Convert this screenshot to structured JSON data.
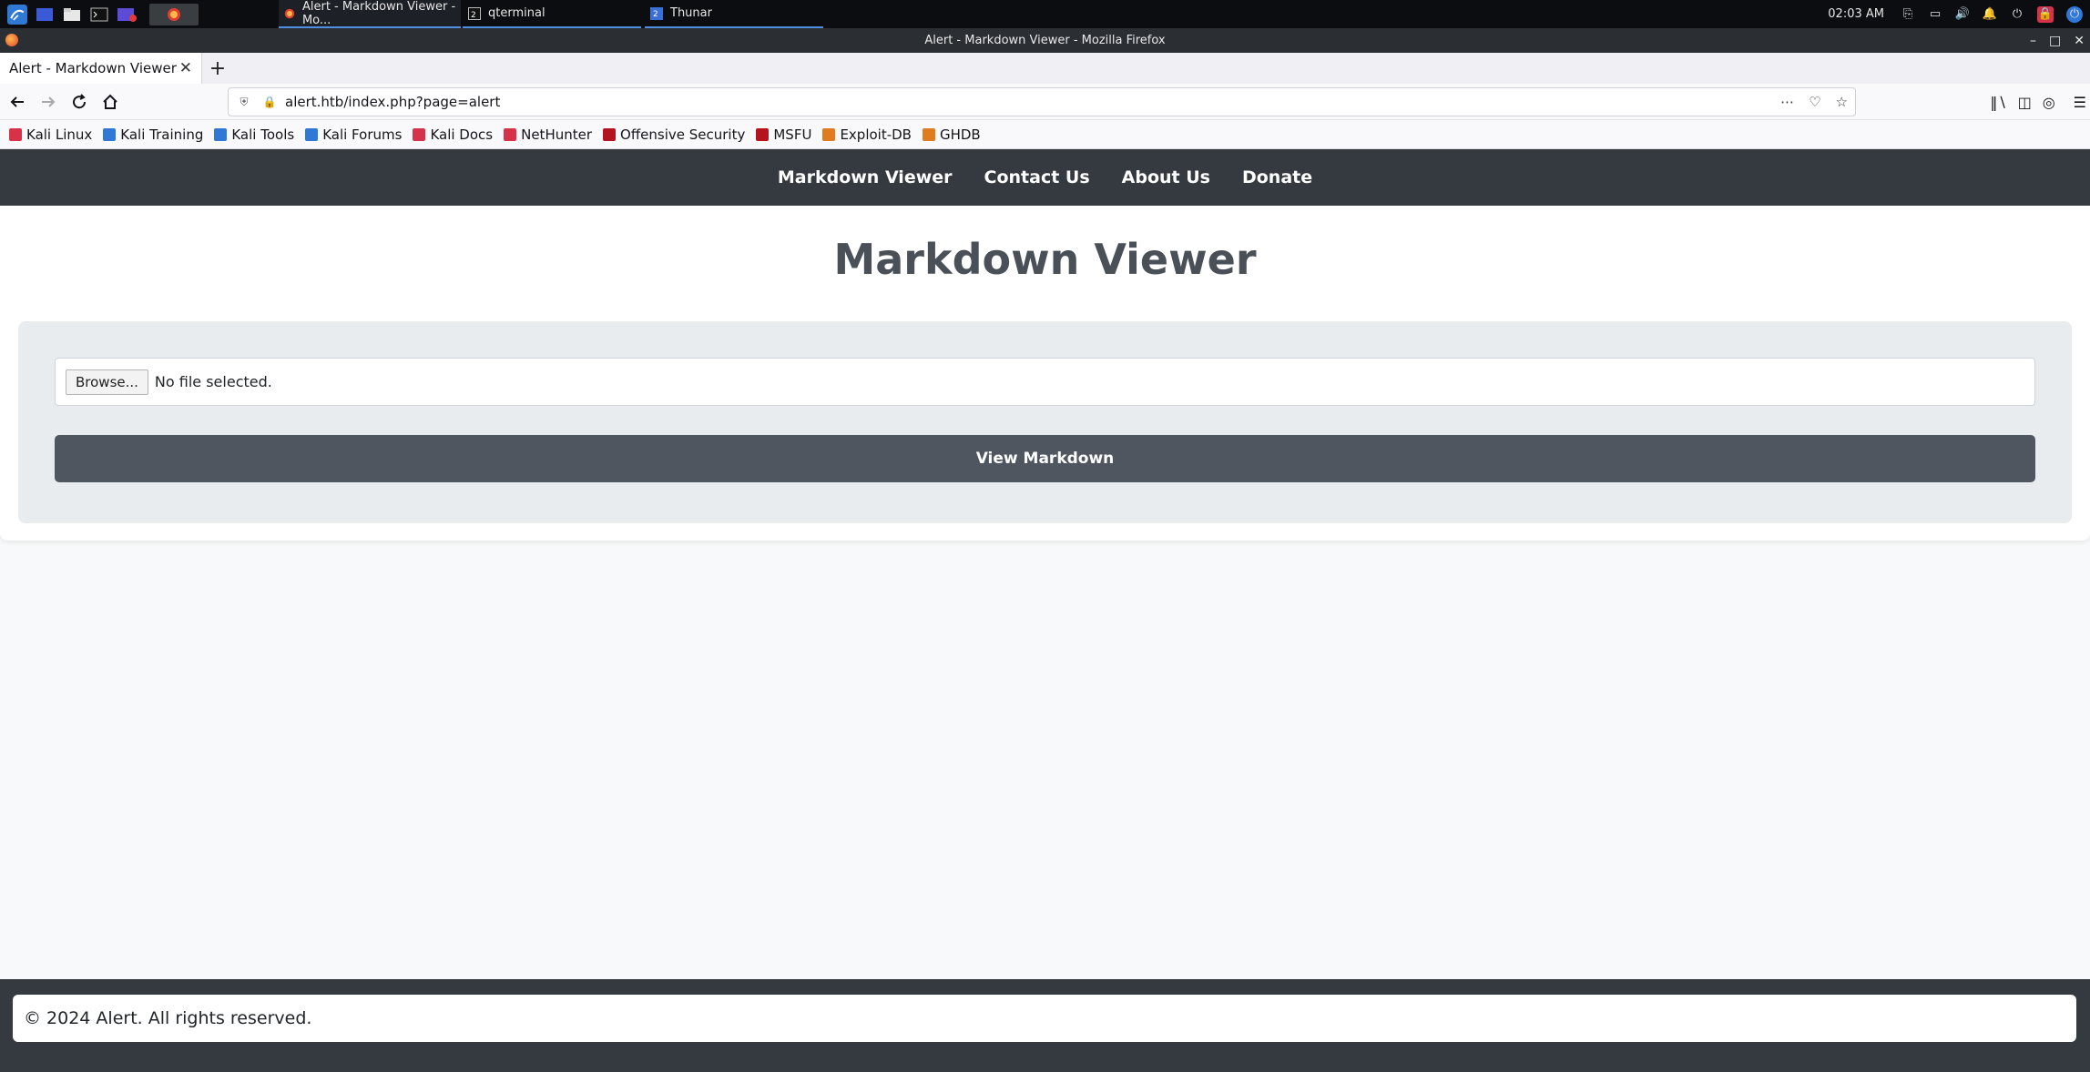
{
  "taskbar": {
    "tasks": [
      {
        "label": "Alert - Markdown Viewer - Mo..."
      },
      {
        "label": "qterminal",
        "badge": "2"
      },
      {
        "label": "Thunar",
        "badge": "2"
      }
    ],
    "clock": "02:03 AM"
  },
  "window": {
    "title": "Alert - Markdown Viewer - Mozilla Firefox"
  },
  "browser": {
    "tab_title": "Alert - Markdown Viewer",
    "url": "alert.htb/index.php?page=alert",
    "bookmarks": [
      {
        "label": "Kali Linux",
        "color": "#d6334a"
      },
      {
        "label": "Kali Training",
        "color": "#2f78d6"
      },
      {
        "label": "Kali Tools",
        "color": "#2f78d6"
      },
      {
        "label": "Kali Forums",
        "color": "#2f78d6"
      },
      {
        "label": "Kali Docs",
        "color": "#d6334a"
      },
      {
        "label": "NetHunter",
        "color": "#d6334a"
      },
      {
        "label": "Offensive Security",
        "color": "#b3141e"
      },
      {
        "label": "MSFU",
        "color": "#b3141e"
      },
      {
        "label": "Exploit-DB",
        "color": "#e07b1f"
      },
      {
        "label": "GHDB",
        "color": "#e07b1f"
      }
    ]
  },
  "site": {
    "nav": [
      "Markdown Viewer",
      "Contact Us",
      "About Us",
      "Donate"
    ],
    "title": "Markdown Viewer",
    "file_input": {
      "button_label": "Browse...",
      "status": "No file selected."
    },
    "submit_label": "View Markdown",
    "footer": "© 2024 Alert. All rights reserved."
  }
}
